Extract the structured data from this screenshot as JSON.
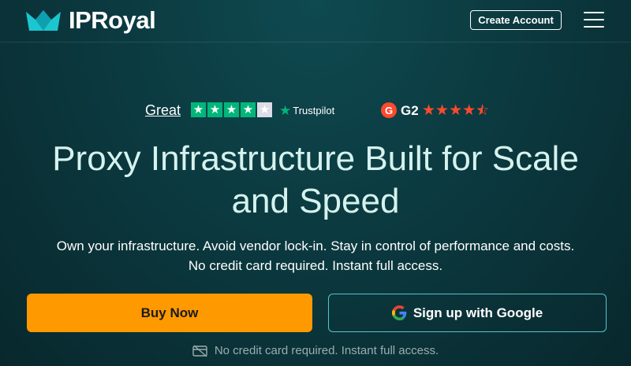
{
  "header": {
    "logo_text": "IPRoyal",
    "create_account": "Create Account"
  },
  "ratings": {
    "trustpilot_label": "Great",
    "trustpilot_brand": "Trustpilot",
    "trustpilot_stars": 4,
    "g2_badge": "G",
    "g2_label": "G2",
    "g2_stars": 4.5
  },
  "hero": {
    "title_line1": "Proxy Infrastructure Built for Scale",
    "title_line2": "and Speed",
    "subtitle_line1": "Own your infrastructure. Avoid vendor lock-in. Stay in control of performance and costs.",
    "subtitle_line2": "No credit card required. Instant full access."
  },
  "actions": {
    "buy_now": "Buy Now",
    "google_signup": "Sign up with Google"
  },
  "footnote": "No credit card required. Instant full access.",
  "colors": {
    "background": "#0b3a40",
    "accent_orange": "#ff9900",
    "google_border": "#59c3cf",
    "trustpilot_green": "#00b67a",
    "g2_red": "#ff492c",
    "logo_teal": "#1cc6d1"
  },
  "icons": {
    "logo": "crown-icon",
    "menu": "hamburger-menu-icon",
    "google": "google-g-icon",
    "footnote": "no-credit-card-icon"
  }
}
